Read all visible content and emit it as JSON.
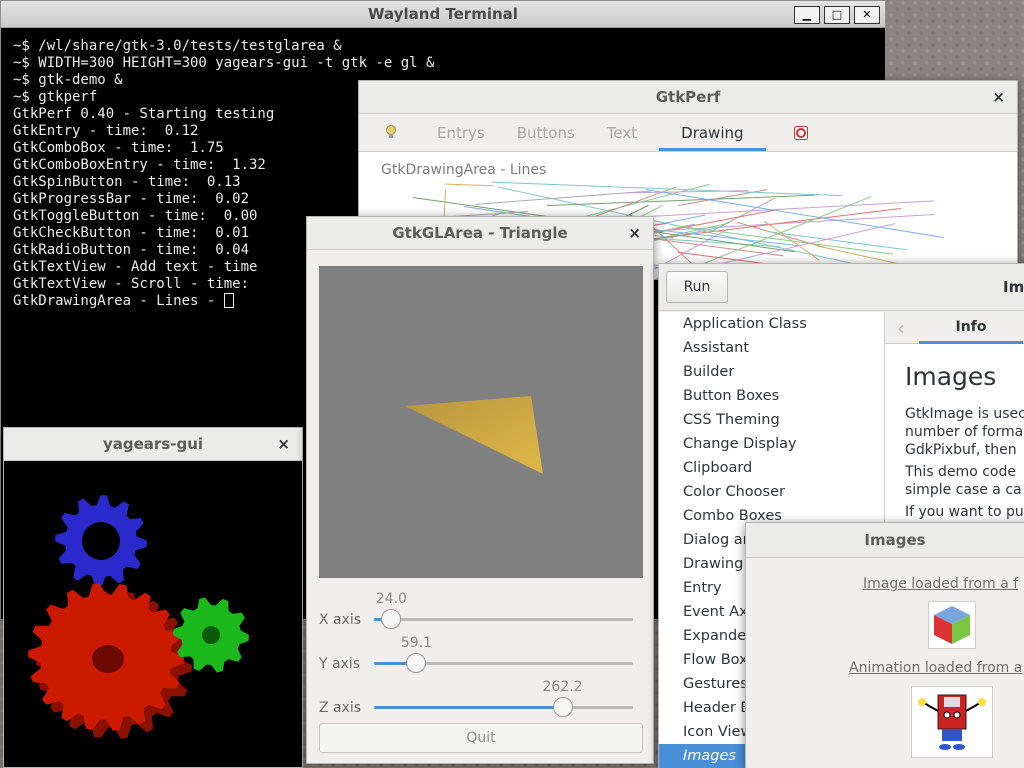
{
  "terminal": {
    "title": "Wayland Terminal",
    "buttons": {
      "minimize": "▁",
      "maximize": "□",
      "close": "✕"
    },
    "lines": [
      "~$ /wl/share/gtk-3.0/tests/testglarea &",
      "~$ WIDTH=300 HEIGHT=300 yagears-gui -t gtk -e gl &",
      "~$ gtk-demo &",
      "~$ gtkperf",
      "GtkPerf 0.40 - Starting testing",
      "GtkEntry - time:  0.12",
      "GtkComboBox - time:  1.75",
      "GtkComboBoxEntry - time:  1.32",
      "GtkSpinButton - time:  0.13",
      "GtkProgressBar - time:  0.02",
      "GtkToggleButton - time:  0.00",
      "GtkCheckButton - time:  0.01",
      "GtkRadioButton - time:  0.04",
      "GtkTextView - Add text - time",
      "GtkTextView - Scroll - time:",
      "GtkDrawingArea - Lines - "
    ]
  },
  "gtkperf": {
    "title": "GtkPerf",
    "close": "×",
    "tabs": [
      "Entrys",
      "Buttons",
      "Text",
      "Drawing"
    ],
    "selected_tab": "Drawing",
    "area_label": "GtkDrawingArea - Lines"
  },
  "glarea": {
    "title": "GtkGLArea - Triangle",
    "close": "×",
    "axes": [
      {
        "name": "X axis",
        "value": "24.0",
        "fraction": 0.067
      },
      {
        "name": "Y axis",
        "value": "59.1",
        "fraction": 0.164
      },
      {
        "name": "Z axis",
        "value": "262.2",
        "fraction": 0.728
      }
    ],
    "quit_label": "Quit",
    "triangle_color": "#c8a040"
  },
  "yagears": {
    "title": "yagears-gui",
    "close": "×",
    "gear_colors": [
      "#2a2acc",
      "#cc1a00",
      "#1ab81a"
    ]
  },
  "gtkdemo": {
    "run_label": "Run",
    "header_title": "Im",
    "items": [
      "Application Class",
      "Assistant",
      "Builder",
      "Button Boxes",
      "CSS Theming",
      "Change Display",
      "Clipboard",
      "Color Chooser",
      "Combo Boxes",
      "Dialog ar",
      "Drawing",
      "Entry",
      "Event Ax",
      "Expande",
      "Flow Box",
      "Gestures",
      "Header E",
      "Icon View",
      "Images"
    ],
    "selected_item": "Images",
    "info_tab": "Info",
    "heading": "Images",
    "paragraphs": [
      "GtkImage is usec",
      "number of forma",
      "GdkPixbuf, then",
      "This demo code",
      "simple case a ca",
      "If you want to pu"
    ]
  },
  "images_window": {
    "title": "Images",
    "link1": "Image loaded from a f",
    "link2": "Animation loaded from a"
  }
}
